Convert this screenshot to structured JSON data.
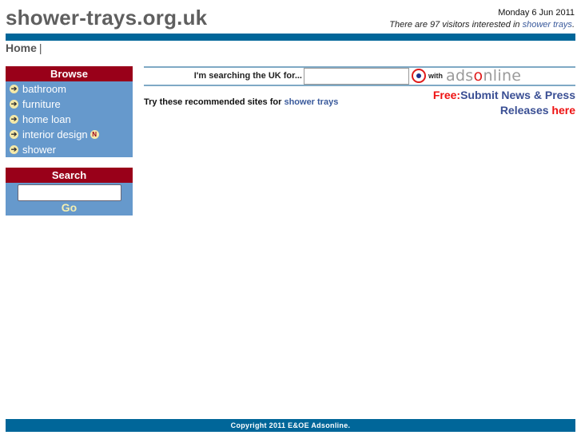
{
  "header": {
    "site_title": "shower-trays.org.uk",
    "date": "Monday 6 Jun 2011",
    "visitors_prefix": "There are 97 visitors interested in ",
    "visitors_link": "shower trays",
    "visitors_suffix": "."
  },
  "nav": {
    "home_label": "Home",
    "separator": "|"
  },
  "browse": {
    "title": "Browse",
    "items": [
      {
        "label": "bathroom",
        "icon": "arrow-right-icon",
        "is_new": false
      },
      {
        "label": "furniture",
        "icon": "arrow-right-icon",
        "is_new": false
      },
      {
        "label": "home loan",
        "icon": "arrow-right-icon",
        "is_new": false
      },
      {
        "label": "interior design",
        "icon": "arrow-right-icon",
        "is_new": true,
        "badge": "N"
      },
      {
        "label": "shower",
        "icon": "arrow-right-icon",
        "is_new": false
      }
    ]
  },
  "side_search": {
    "title": "Search",
    "input_value": "",
    "go_label": "Go"
  },
  "main_search": {
    "label": "I'm searching the UK for...",
    "input_value": "",
    "with_label": "with",
    "logo_prefix": "ads",
    "logo_o": "o",
    "logo_suffix": "nline"
  },
  "recommend": {
    "prefix": "Try these recommended sites for ",
    "link": "shower trays"
  },
  "promo": {
    "free": "Free:",
    "line1": "Submit News & Press",
    "line2": "Releases ",
    "here": "here"
  },
  "footer": {
    "copyright": "Copyright 2011 E&OE Adsonline."
  },
  "colors": {
    "brand_bar": "#006699",
    "box_header": "#990019",
    "box_body": "#6699cc",
    "link": "#3a5a9c",
    "promo_red": "#ee1111"
  }
}
